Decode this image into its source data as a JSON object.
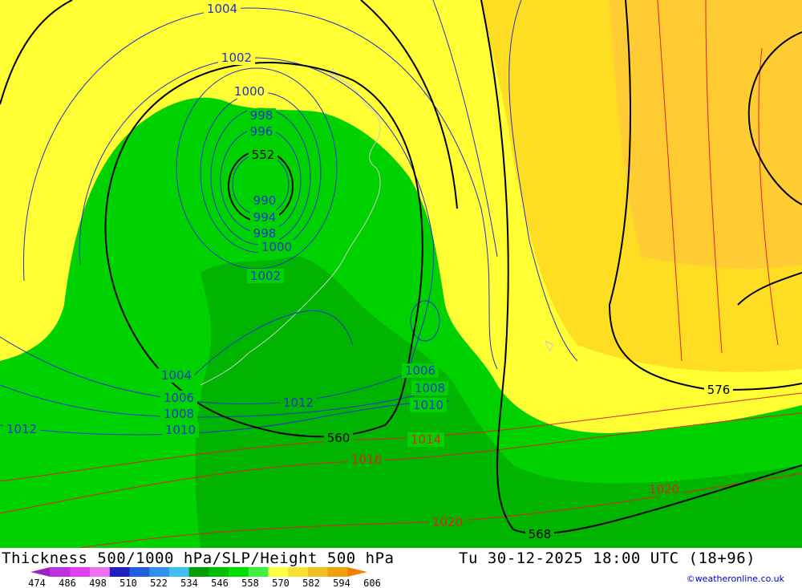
{
  "map": {
    "isobars_blue": [
      {
        "name": "isobar-1004-top",
        "text": "1004"
      },
      {
        "name": "isobar-1002-top",
        "text": "1002"
      },
      {
        "name": "isobar-1000-top",
        "text": "1000"
      },
      {
        "name": "isobar-998-top",
        "text": "998"
      },
      {
        "name": "isobar-996-top",
        "text": "996"
      },
      {
        "name": "isobar-990",
        "text": "990"
      },
      {
        "name": "isobar-994",
        "text": "994"
      },
      {
        "name": "isobar-998-bottom",
        "text": "998"
      },
      {
        "name": "isobar-1000-bottom",
        "text": "1000"
      },
      {
        "name": "isobar-1002-bottom",
        "text": "1002"
      },
      {
        "name": "isobar-1004-left",
        "text": "1004"
      },
      {
        "name": "isobar-1006-left",
        "text": "1006"
      },
      {
        "name": "isobar-1008-left",
        "text": "1008"
      },
      {
        "name": "isobar-1010-left",
        "text": "1010"
      },
      {
        "name": "isobar-1012-far-left",
        "text": "1012"
      },
      {
        "name": "isobar-1012-center",
        "text": "1012"
      },
      {
        "name": "isobar-1006-right",
        "text": "1006"
      },
      {
        "name": "isobar-1008-right",
        "text": "1008"
      },
      {
        "name": "isobar-1010-right",
        "text": "1010"
      }
    ],
    "isobars_red": [
      {
        "name": "isobar-1014",
        "text": "1014"
      },
      {
        "name": "isobar-1016",
        "text": "1016"
      },
      {
        "name": "isobar-1020-bottom",
        "text": "1020"
      },
      {
        "name": "isobar-1020-right",
        "text": "1020"
      }
    ],
    "heights_black": [
      {
        "name": "height-552",
        "text": "552"
      },
      {
        "name": "height-560",
        "text": "560"
      },
      {
        "name": "height-568",
        "text": "568"
      },
      {
        "name": "height-576",
        "text": "576"
      }
    ]
  },
  "footer": {
    "title": "Thickness 500/1000 hPa/SLP/Height 500 hPa",
    "valid_time": "Tu 30-12-2025 18:00 UTC (18+96)",
    "credit": "©weatheronline.co.uk"
  },
  "scale": {
    "ticks": [
      "474",
      "486",
      "498",
      "510",
      "522",
      "534",
      "546",
      "558",
      "570",
      "582",
      "594",
      "606"
    ],
    "colors": [
      "#a020c8",
      "#c030e0",
      "#e040f0",
      "#f070f0",
      "#2020c0",
      "#2060e0",
      "#3090f0",
      "#40c0f0",
      "#00a000",
      "#00c000",
      "#00e000",
      "#40f040",
      "#ffff40",
      "#f8e030",
      "#f0c020",
      "#f0a010",
      "#f08000"
    ]
  },
  "colors": {
    "green_dark": "#00b400",
    "green": "#00d200",
    "yellow": "#ffff33",
    "yellow_orange": "#ffdd22",
    "orange": "#ffcc33",
    "isobar_blue": "#2233cc",
    "isobar_red": "#dd2222",
    "height_black": "#000000",
    "coast": "#cccccc"
  }
}
